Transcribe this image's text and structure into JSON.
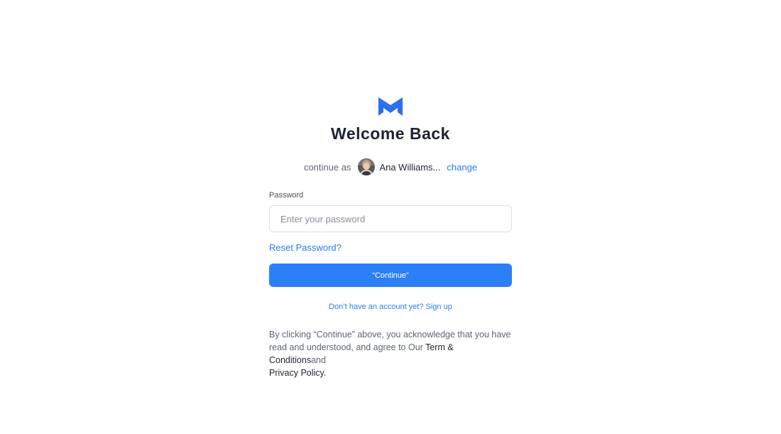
{
  "brand": {
    "logo_icon": "m-logo-icon",
    "accent_color": "#2b7ff7"
  },
  "header": {
    "title": "Welcome Back"
  },
  "account": {
    "continue_label": "continue as",
    "user_name": "Ana Williams...",
    "change_label": "change",
    "avatar_icon": "avatar-photo"
  },
  "form": {
    "password_label": "Password",
    "password_value": "",
    "password_placeholder": "Enter your password",
    "reset_label": "Reset Password?",
    "continue_label": "“Continue”",
    "signup_label": "Don’t have an account yet? Sign up"
  },
  "legal": {
    "prefix": "By clicking “Continue” above, you acknowledge that you have read and understood, and agree to Our ",
    "terms_label": "Term & Conditions",
    "and_label": "and",
    "privacy_label": "Privacy Policy."
  }
}
